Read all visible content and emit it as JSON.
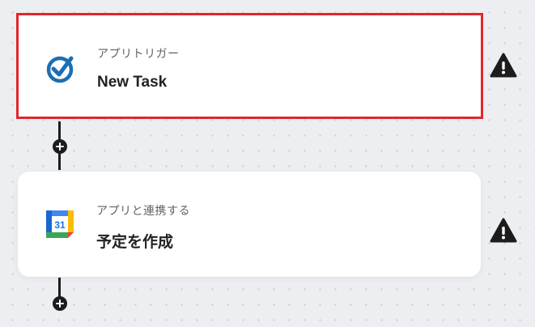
{
  "flow": {
    "steps": [
      {
        "label": "アプリトリガー",
        "title": "New Task",
        "icon": "task-checkbox-icon",
        "selected": true,
        "warning_icon": "warning-triangle-icon"
      },
      {
        "label": "アプリと連携する",
        "title": "予定を作成",
        "icon": "google-calendar-icon",
        "icon_text": "31",
        "selected": false,
        "warning_icon": "warning-triangle-icon"
      }
    ],
    "add_button_icon": "plus-icon"
  },
  "colors": {
    "selected_border": "#e0262b",
    "task_icon": "#1a6fb5",
    "connector": "#1c1c1c",
    "warning": "#1c1c1c"
  }
}
